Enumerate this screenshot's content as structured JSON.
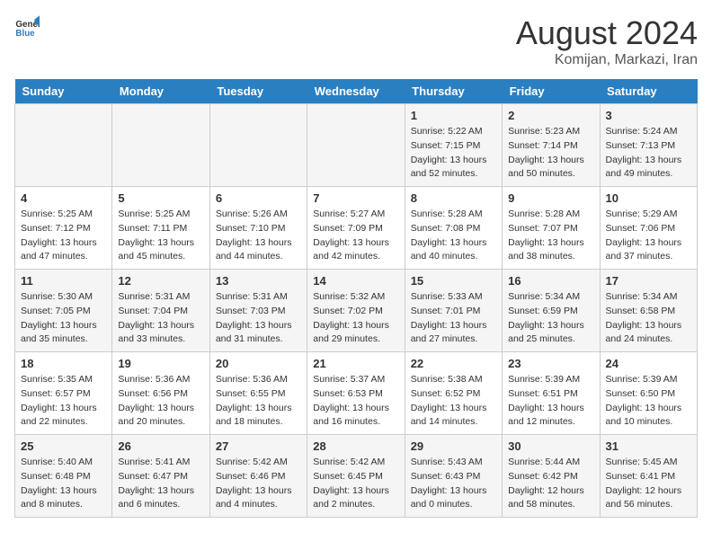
{
  "header": {
    "logo_general": "General",
    "logo_blue": "Blue",
    "title": "August 2024",
    "subtitle": "Komijan, Markazi, Iran"
  },
  "days_of_week": [
    "Sunday",
    "Monday",
    "Tuesday",
    "Wednesday",
    "Thursday",
    "Friday",
    "Saturday"
  ],
  "weeks": [
    [
      {
        "day": "",
        "sunrise": "",
        "sunset": "",
        "daylight": ""
      },
      {
        "day": "",
        "sunrise": "",
        "sunset": "",
        "daylight": ""
      },
      {
        "day": "",
        "sunrise": "",
        "sunset": "",
        "daylight": ""
      },
      {
        "day": "",
        "sunrise": "",
        "sunset": "",
        "daylight": ""
      },
      {
        "day": "1",
        "sunrise": "5:22 AM",
        "sunset": "7:15 PM",
        "daylight": "13 hours and 52 minutes."
      },
      {
        "day": "2",
        "sunrise": "5:23 AM",
        "sunset": "7:14 PM",
        "daylight": "13 hours and 50 minutes."
      },
      {
        "day": "3",
        "sunrise": "5:24 AM",
        "sunset": "7:13 PM",
        "daylight": "13 hours and 49 minutes."
      }
    ],
    [
      {
        "day": "4",
        "sunrise": "5:25 AM",
        "sunset": "7:12 PM",
        "daylight": "13 hours and 47 minutes."
      },
      {
        "day": "5",
        "sunrise": "5:25 AM",
        "sunset": "7:11 PM",
        "daylight": "13 hours and 45 minutes."
      },
      {
        "day": "6",
        "sunrise": "5:26 AM",
        "sunset": "7:10 PM",
        "daylight": "13 hours and 44 minutes."
      },
      {
        "day": "7",
        "sunrise": "5:27 AM",
        "sunset": "7:09 PM",
        "daylight": "13 hours and 42 minutes."
      },
      {
        "day": "8",
        "sunrise": "5:28 AM",
        "sunset": "7:08 PM",
        "daylight": "13 hours and 40 minutes."
      },
      {
        "day": "9",
        "sunrise": "5:28 AM",
        "sunset": "7:07 PM",
        "daylight": "13 hours and 38 minutes."
      },
      {
        "day": "10",
        "sunrise": "5:29 AM",
        "sunset": "7:06 PM",
        "daylight": "13 hours and 37 minutes."
      }
    ],
    [
      {
        "day": "11",
        "sunrise": "5:30 AM",
        "sunset": "7:05 PM",
        "daylight": "13 hours and 35 minutes."
      },
      {
        "day": "12",
        "sunrise": "5:31 AM",
        "sunset": "7:04 PM",
        "daylight": "13 hours and 33 minutes."
      },
      {
        "day": "13",
        "sunrise": "5:31 AM",
        "sunset": "7:03 PM",
        "daylight": "13 hours and 31 minutes."
      },
      {
        "day": "14",
        "sunrise": "5:32 AM",
        "sunset": "7:02 PM",
        "daylight": "13 hours and 29 minutes."
      },
      {
        "day": "15",
        "sunrise": "5:33 AM",
        "sunset": "7:01 PM",
        "daylight": "13 hours and 27 minutes."
      },
      {
        "day": "16",
        "sunrise": "5:34 AM",
        "sunset": "6:59 PM",
        "daylight": "13 hours and 25 minutes."
      },
      {
        "day": "17",
        "sunrise": "5:34 AM",
        "sunset": "6:58 PM",
        "daylight": "13 hours and 24 minutes."
      }
    ],
    [
      {
        "day": "18",
        "sunrise": "5:35 AM",
        "sunset": "6:57 PM",
        "daylight": "13 hours and 22 minutes."
      },
      {
        "day": "19",
        "sunrise": "5:36 AM",
        "sunset": "6:56 PM",
        "daylight": "13 hours and 20 minutes."
      },
      {
        "day": "20",
        "sunrise": "5:36 AM",
        "sunset": "6:55 PM",
        "daylight": "13 hours and 18 minutes."
      },
      {
        "day": "21",
        "sunrise": "5:37 AM",
        "sunset": "6:53 PM",
        "daylight": "13 hours and 16 minutes."
      },
      {
        "day": "22",
        "sunrise": "5:38 AM",
        "sunset": "6:52 PM",
        "daylight": "13 hours and 14 minutes."
      },
      {
        "day": "23",
        "sunrise": "5:39 AM",
        "sunset": "6:51 PM",
        "daylight": "13 hours and 12 minutes."
      },
      {
        "day": "24",
        "sunrise": "5:39 AM",
        "sunset": "6:50 PM",
        "daylight": "13 hours and 10 minutes."
      }
    ],
    [
      {
        "day": "25",
        "sunrise": "5:40 AM",
        "sunset": "6:48 PM",
        "daylight": "13 hours and 8 minutes."
      },
      {
        "day": "26",
        "sunrise": "5:41 AM",
        "sunset": "6:47 PM",
        "daylight": "13 hours and 6 minutes."
      },
      {
        "day": "27",
        "sunrise": "5:42 AM",
        "sunset": "6:46 PM",
        "daylight": "13 hours and 4 minutes."
      },
      {
        "day": "28",
        "sunrise": "5:42 AM",
        "sunset": "6:45 PM",
        "daylight": "13 hours and 2 minutes."
      },
      {
        "day": "29",
        "sunrise": "5:43 AM",
        "sunset": "6:43 PM",
        "daylight": "13 hours and 0 minutes."
      },
      {
        "day": "30",
        "sunrise": "5:44 AM",
        "sunset": "6:42 PM",
        "daylight": "12 hours and 58 minutes."
      },
      {
        "day": "31",
        "sunrise": "5:45 AM",
        "sunset": "6:41 PM",
        "daylight": "12 hours and 56 minutes."
      }
    ]
  ]
}
